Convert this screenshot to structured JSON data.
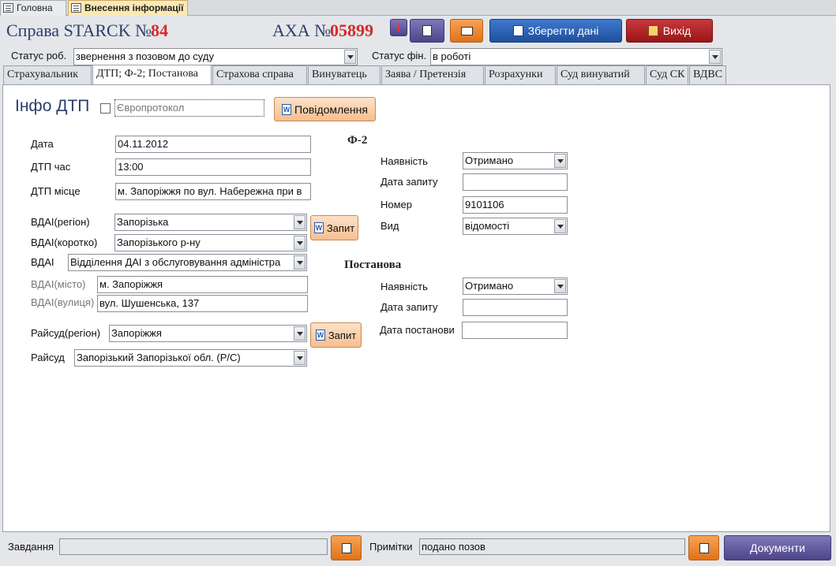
{
  "doc_tabs": [
    {
      "label": "Головна",
      "active": false
    },
    {
      "label": "Внесення інформації",
      "active": true
    }
  ],
  "header": {
    "case_label": "Справа STARCK №",
    "case_number": "84",
    "axa_label": "АХА №",
    "axa_number": "05899",
    "save_label": "Зберегти дані",
    "exit_label": "Вихід"
  },
  "status": {
    "work_label": "Статус роб.",
    "work_value": "звернення з позовом до суду",
    "fin_label": "Статус фін.",
    "fin_value": "в роботі"
  },
  "form_tabs": [
    "Страхувальник",
    "ДТП; Ф-2; Постанова",
    "Страхова справа",
    "Винуватець",
    "Заява / Претензія",
    "Розрахунки",
    "Суд винуватий",
    "Суд СК",
    "ВДВС"
  ],
  "info": {
    "title": "Інфо ДТП",
    "europrotocol_label": "Європротокол",
    "europrotocol_checked": false,
    "notify_label": "Повідомлення",
    "date_label": "Дата",
    "date_value": "04.11.2012",
    "time_label": "ДТП час",
    "time_value": "13:00",
    "place_label": "ДТП місце",
    "place_value": "м. Запоріжжя по вул. Набережна при в",
    "vdai_region_label": "ВДАІ(регіон)",
    "vdai_region_value": "Запорізька",
    "vdai_short_label": "ВДАІ(коротко)",
    "vdai_short_value": "Запорізького р-ну",
    "vdai_label": "ВДАІ",
    "vdai_value": "Відділення ДАІ з обслуговування адміністра",
    "vdai_city_label": "ВДАІ(місто)",
    "vdai_city_value": "м. Запоріжжя",
    "vdai_street_label": "ВДАІ(вулиця)",
    "vdai_street_value": "вул. Шушенська, 137",
    "request_label": "Запит",
    "court_region_label": "Райсуд(регіон)",
    "court_region_value": "Запоріжжя",
    "court_label": "Райсуд",
    "court_value": "Запорізький Запорізької обл. (Р/С)",
    "request2_label": "Запит"
  },
  "f2": {
    "title": "Ф-2",
    "presence_label": "Наявність",
    "presence_value": "Отримано",
    "req_date_label": "Дата запиту",
    "req_date_value": "",
    "number_label": "Номер",
    "number_value": "9101106",
    "type_label": "Вид",
    "type_value": "відомості"
  },
  "decree": {
    "title": "Постанова",
    "presence_label": "Наявність",
    "presence_value": "Отримано",
    "req_date_label": "Дата запиту",
    "req_date_value": "",
    "decree_date_label": "Дата постанови",
    "decree_date_value": ""
  },
  "footer": {
    "task_label": "Завдання",
    "task_value": "",
    "notes_label": "Примітки",
    "notes_value": "подано позов",
    "documents_label": "Документи"
  }
}
